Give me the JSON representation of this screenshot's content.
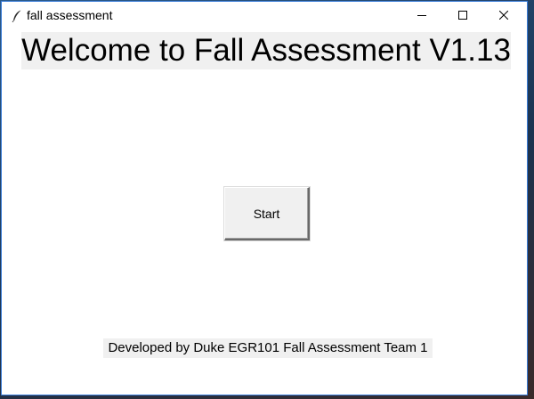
{
  "window": {
    "title": "fall assessment",
    "app_icon": "feather-icon",
    "controls": {
      "minimize_icon": "minimize-icon",
      "maximize_icon": "maximize-icon",
      "close_icon": "close-icon"
    }
  },
  "main": {
    "heading": "Welcome to Fall Assessment V1.13",
    "start_button_label": "Start",
    "footer_text": "Developed by Duke EGR101 Fall Assessment Team 1"
  },
  "colors": {
    "window_border": "#3b7dd8",
    "label_background": "#f0f0f0",
    "button_face": "#f0f0f0"
  }
}
